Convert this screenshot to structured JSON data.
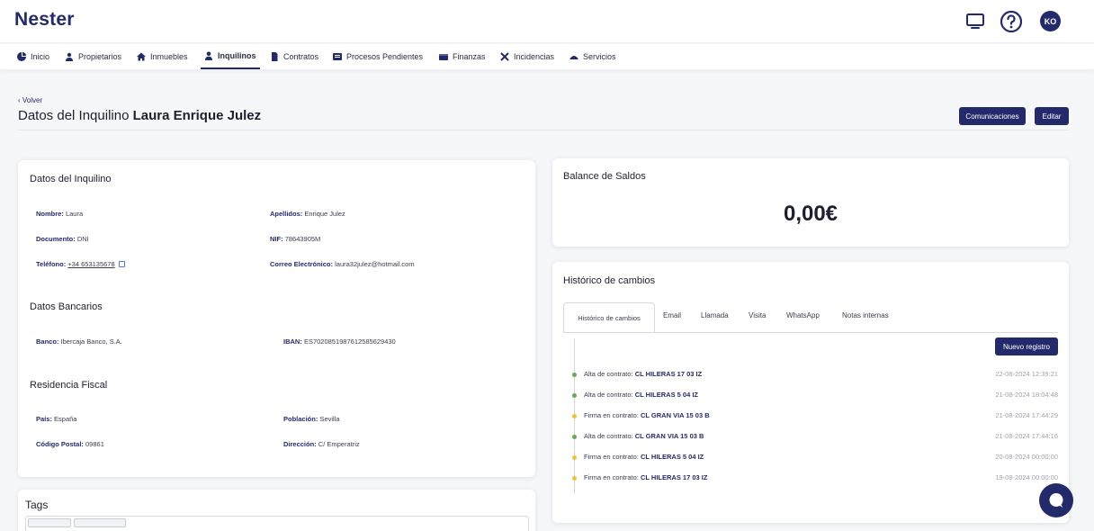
{
  "app": {
    "name": "Nester"
  },
  "header": {
    "avatar_initials": "KO",
    "icons": [
      "monitor-icon",
      "help-icon"
    ]
  },
  "nav": {
    "items": [
      {
        "label": "Inicio",
        "icon": "pie-chart-icon"
      },
      {
        "label": "Propietarios",
        "icon": "user-group-icon"
      },
      {
        "label": "Inmuebles",
        "icon": "home-icon"
      },
      {
        "label": "Inquilinos",
        "icon": "user-icon",
        "active": true
      },
      {
        "label": "Contratos",
        "icon": "document-icon"
      },
      {
        "label": "Procesos Pendientes",
        "icon": "list-icon"
      },
      {
        "label": "Finanzas",
        "icon": "wallet-icon"
      },
      {
        "label": "Incidencias",
        "icon": "tools-icon"
      },
      {
        "label": "Servicios",
        "icon": "service-icon"
      }
    ]
  },
  "page": {
    "back_label": "Volver",
    "title_prefix": "Datos del Inquilino",
    "title_name": "Laura Enrique Julez",
    "btn_comunicaciones": "Comunicaciones",
    "btn_editar": "Editar"
  },
  "tenant": {
    "section_title": "Datos del Inquilino",
    "fields": {
      "nombre": {
        "label": "Nombre:",
        "value": "Laura"
      },
      "apellidos": {
        "label": "Apellidos:",
        "value": "Enrique Julez"
      },
      "documento": {
        "label": "Documento:",
        "value": "DNI"
      },
      "nif": {
        "label": "NIF:",
        "value": "78643905M"
      },
      "telefono": {
        "label": "Teléfono:",
        "value": "+34 653135678"
      },
      "correo": {
        "label": "Correo Electrónico:",
        "value": "laura32julez@hotmail.com"
      }
    }
  },
  "bank": {
    "section_title": "Datos Bancarios",
    "banco": {
      "label": "Banco:",
      "value": "Ibercaja Banco, S.A."
    },
    "iban": {
      "label": "IBAN:",
      "value": "ES7020851987612585629430"
    }
  },
  "fiscal": {
    "section_title": "Residencia Fiscal",
    "pais": {
      "label": "País:",
      "value": "España"
    },
    "poblacion": {
      "label": "Población:",
      "value": "Sevilla"
    },
    "cp": {
      "label": "Código Postal:",
      "value": "09861"
    },
    "direccion": {
      "label": "Dirección:",
      "value": "C/ Emperatriz"
    }
  },
  "tags": {
    "section_title": "Tags"
  },
  "balance": {
    "title": "Balance de Saldos",
    "amount": "0,00€"
  },
  "history": {
    "title": "Histórico de cambios",
    "tabs": [
      "Histórico de cambios",
      "Email",
      "Llamada",
      "Visita",
      "WhatsApp",
      "Notas internas"
    ],
    "new_button": "Nuevo registro",
    "entries": [
      {
        "action": "Alta de contrato:",
        "target": "CL HILERAS 17 03 IZ",
        "date": "22-08-2024 12:39:21",
        "color": "#6aa84f"
      },
      {
        "action": "Alta de contrato:",
        "target": "CL HILERAS 5 04 IZ",
        "date": "21-08-2024 18:04:48",
        "color": "#6aa84f"
      },
      {
        "action": "Firma en contrato:",
        "target": "CL GRAN VIA 15 03 B",
        "date": "21-08-2024 17:44:29",
        "color": "#f1c232"
      },
      {
        "action": "Alta de contrato:",
        "target": "CL GRAN VIA 15 03 B",
        "date": "21-08-2024 17:44:16",
        "color": "#6aa84f"
      },
      {
        "action": "Firma en contrato:",
        "target": "CL HILERAS 5 04 IZ",
        "date": "20-08-2024 00:00:00",
        "color": "#f1c232"
      },
      {
        "action": "Firma en contrato:",
        "target": "CL HILERAS 17 03 IZ",
        "date": "19-08-2024 00:00:00",
        "color": "#f1c232"
      }
    ]
  },
  "colors": {
    "brand": "#232a6b",
    "success": "#6aa84f",
    "warning": "#f1c232"
  }
}
